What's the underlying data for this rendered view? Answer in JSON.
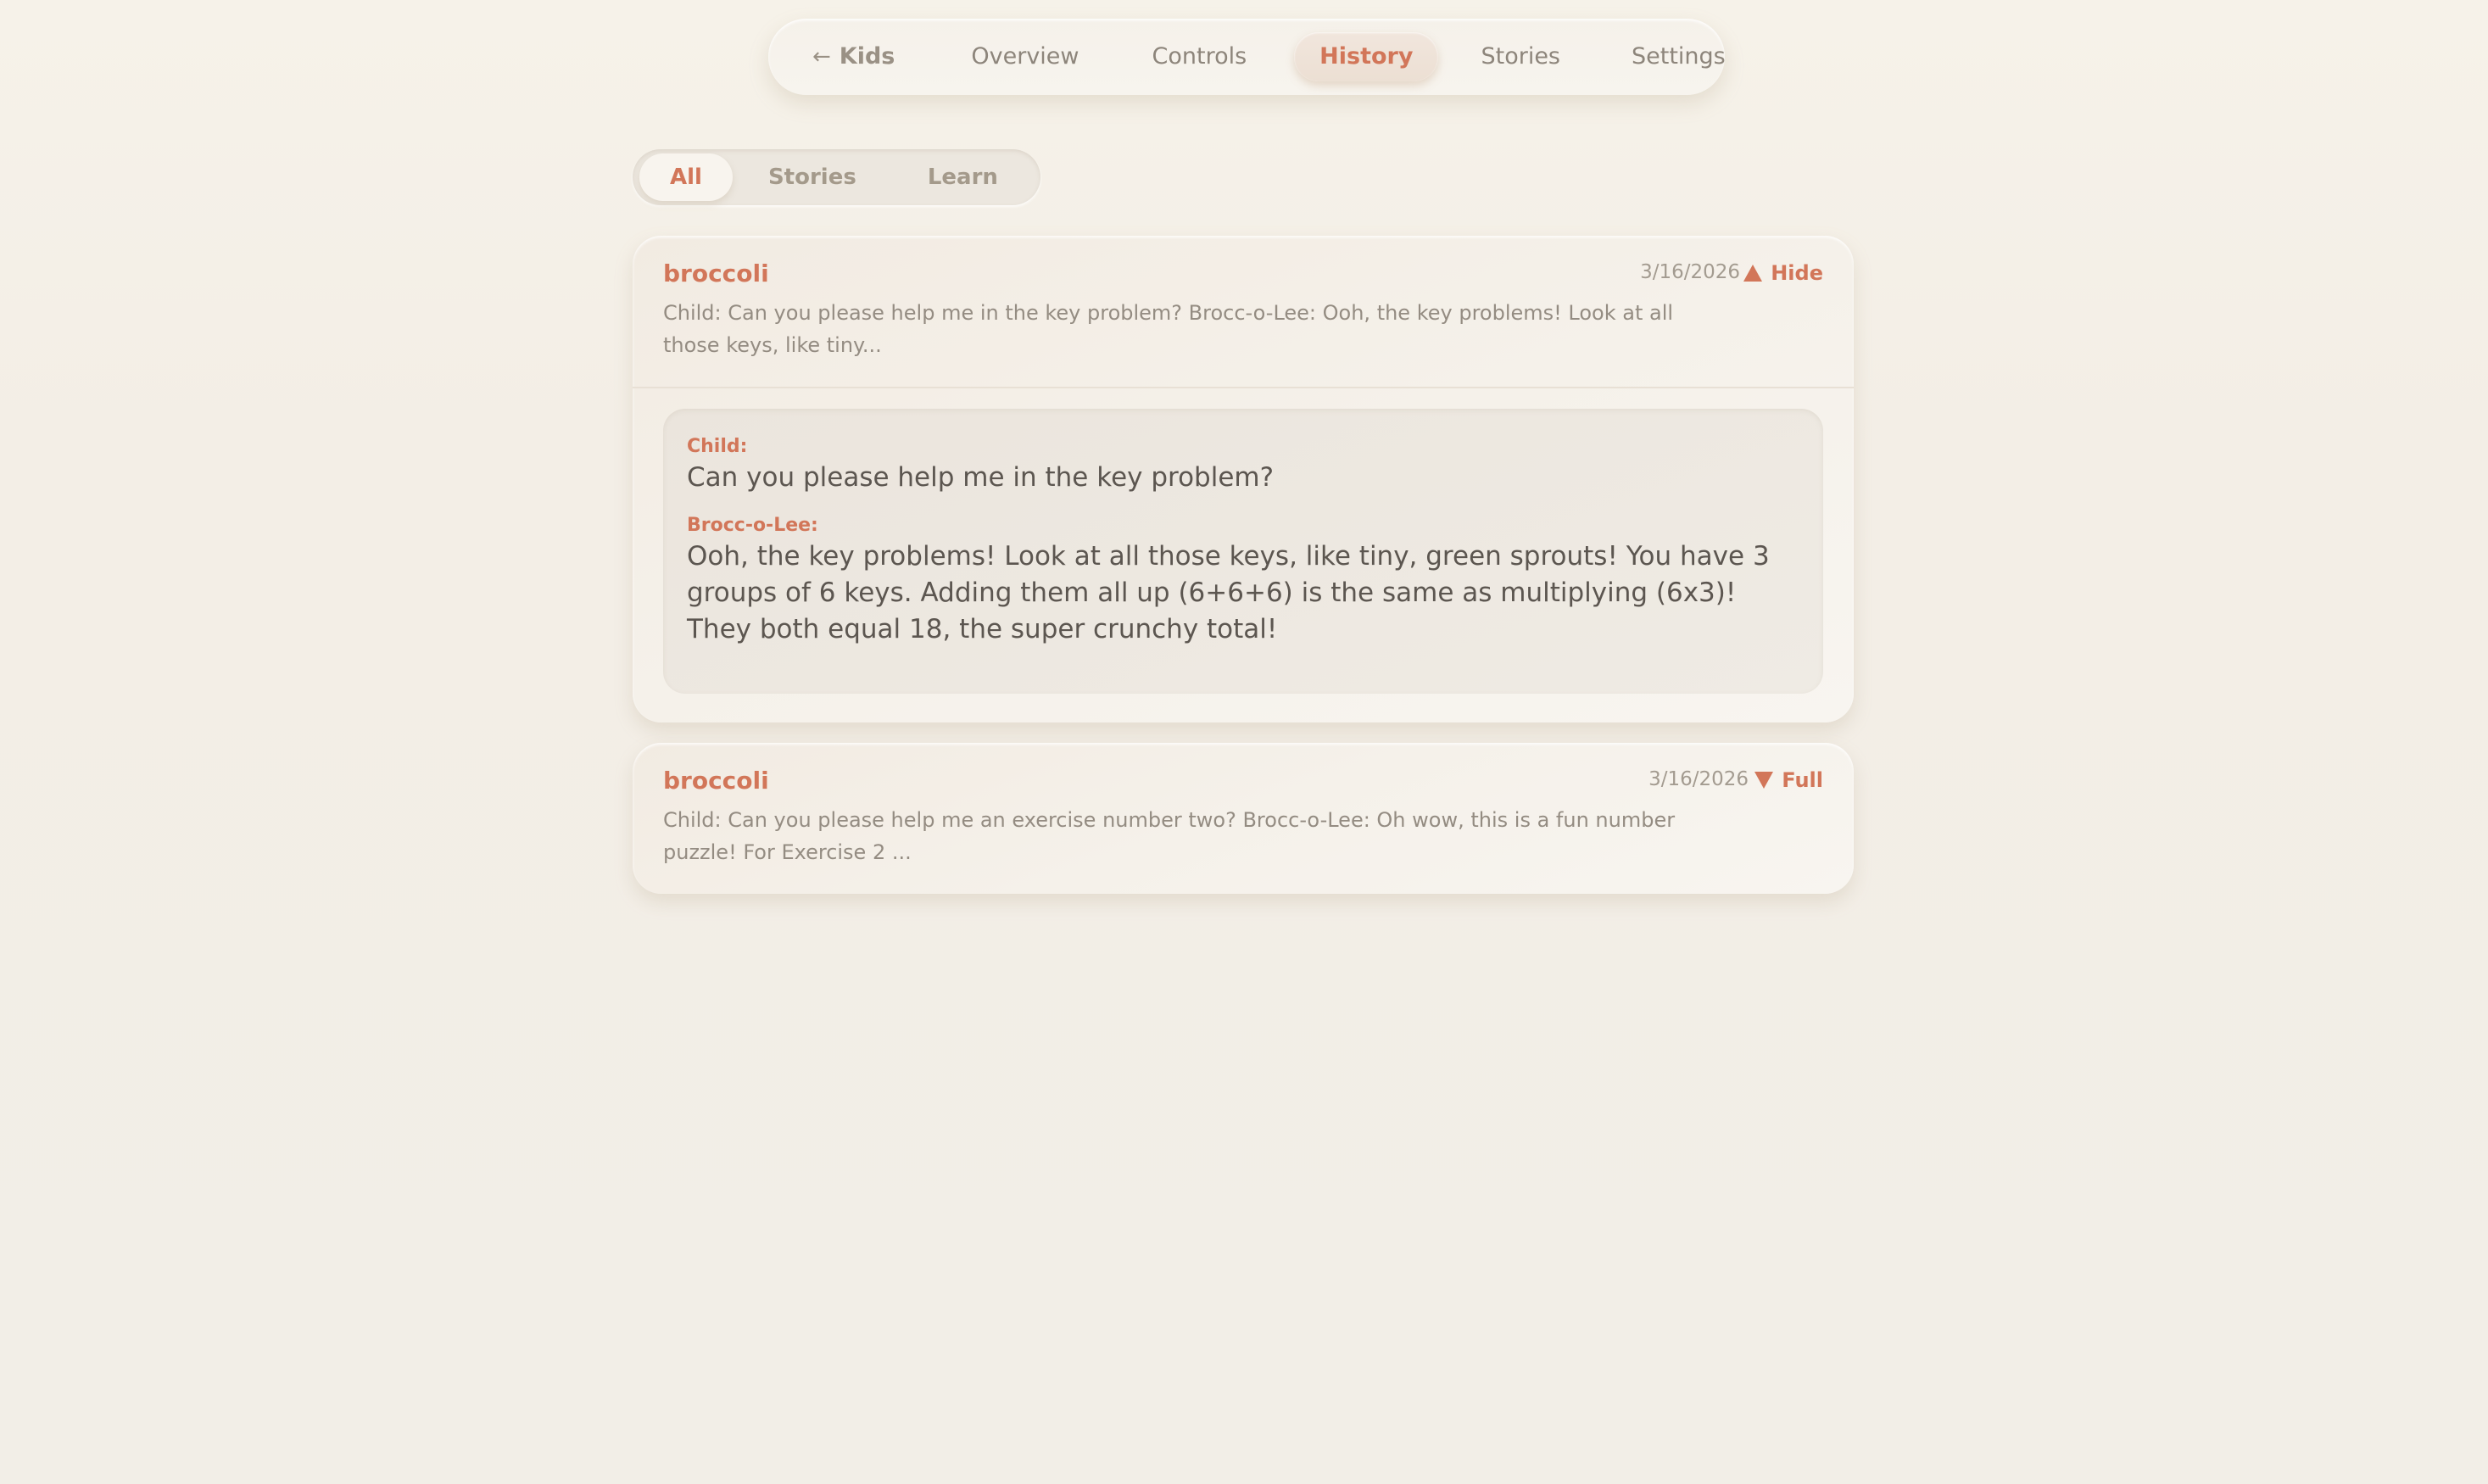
{
  "nav": {
    "back_label": "Kids",
    "items": [
      {
        "label": "Overview",
        "active": false
      },
      {
        "label": "Controls",
        "active": false
      },
      {
        "label": "History",
        "active": true
      },
      {
        "label": "Stories",
        "active": false
      },
      {
        "label": "Settings",
        "active": false
      }
    ]
  },
  "filters": [
    {
      "label": "All",
      "active": true
    },
    {
      "label": "Stories",
      "active": false
    },
    {
      "label": "Learn",
      "active": false
    }
  ],
  "entries": [
    {
      "title": "broccoli",
      "date": "3/16/2026",
      "toggle_label": "Hide",
      "expanded": true,
      "preview": "Child: Can you please help me in the key problem? Brocc-o-Lee: Ooh, the key problems! Look at all those keys, like tiny...",
      "messages": [
        {
          "speaker": "Child:",
          "text": "Can you please help me in the key problem?"
        },
        {
          "speaker": "Brocc-o-Lee:",
          "text": "Ooh, the key problems! Look at all those keys, like tiny, green sprouts! You have 3 groups of 6 keys. Adding them all up (6+6+6) is the same as multiplying (6x3)! They both equal 18, the super crunchy total!"
        }
      ]
    },
    {
      "title": "broccoli",
      "date": "3/16/2026",
      "toggle_label": "Full",
      "expanded": false,
      "preview": "Child: Can you please help me an exercise number two? Brocc-o-Lee: Oh wow, this is a fun number puzzle! For Exercise 2 ..."
    }
  ],
  "colors": {
    "accent": "#d27659",
    "background": "#f2eee7",
    "muted_text": "#948c82",
    "body_text": "#5c5650"
  }
}
